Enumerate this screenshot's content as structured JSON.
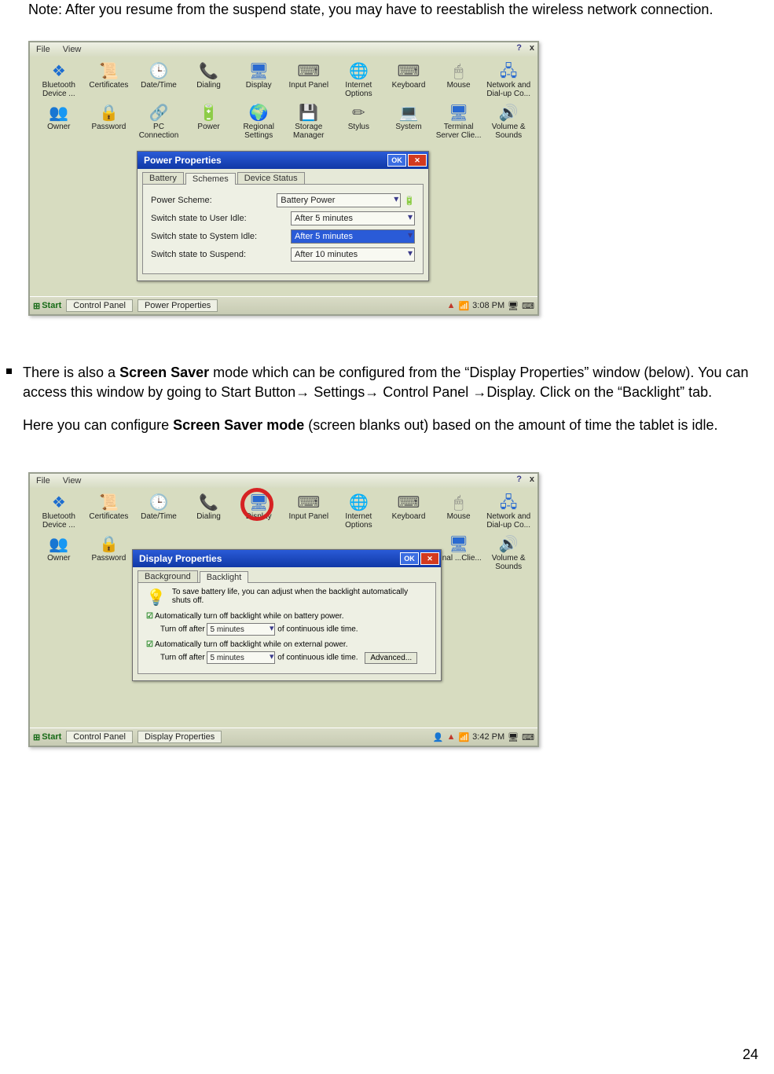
{
  "note": "Note:  After you resume from the suspend state, you may have to reestablish the wireless network connection.",
  "bullet": {
    "part1": "There is also a ",
    "bold1": "Screen Saver",
    "part2": " mode which can be configured from the “Display Properties” window (below).  You can access this window by going to Start Button",
    "arrow": "→",
    "settings": " Settings",
    "control_panel": " Control Panel ",
    "display_text": "Display.  Click on the “Backlight” tab."
  },
  "subpara": {
    "part1": "Here you can configure ",
    "bold": "Screen Saver mode",
    "part2": " (screen blanks out) based on the amount of time the tablet is idle."
  },
  "page_number": "24",
  "shot1": {
    "menu": {
      "file": "File",
      "view": "View",
      "help": "?",
      "close": "x"
    },
    "icons_row1": [
      "Bluetooth Device ...",
      "Certificates",
      "Date/Time",
      "Dialing",
      "Display",
      "Input Panel",
      "Internet Options",
      "Keyboard",
      "Mouse",
      "Network and Dial-up Co..."
    ],
    "icons_row2": [
      "Owner",
      "Password",
      "PC Connection",
      "Power",
      "Regional Settings",
      "Storage Manager",
      "Stylus",
      "System",
      "Terminal Server Clie...",
      "Volume & Sounds"
    ],
    "dialog": {
      "title": "Power Properties",
      "ok": "OK",
      "tabs": [
        "Battery",
        "Schemes",
        "Device Status"
      ],
      "active_tab": 1,
      "fields": {
        "scheme_label": "Power Scheme:",
        "scheme_value": "Battery Power",
        "user_idle_label": "Switch state to User Idle:",
        "user_idle_value": "After 5 minutes",
        "system_idle_label": "Switch state to System Idle:",
        "system_idle_value": "After 5 minutes",
        "suspend_label": "Switch state to Suspend:",
        "suspend_value": "After 10 minutes"
      }
    },
    "taskbar": {
      "start": "Start",
      "task1": "Control Panel",
      "task2": "Power Properties",
      "time": "3:08 PM"
    }
  },
  "shot2": {
    "menu": {
      "file": "File",
      "view": "View",
      "help": "?",
      "close": "x"
    },
    "icons_row1": [
      "Bluetooth Device ...",
      "Certificates",
      "Date/Time",
      "Dialing",
      "Display",
      "Input Panel",
      "Internet Options",
      "Keyboard",
      "Mouse",
      "Network and Dial-up Co..."
    ],
    "icons_row2_partial": [
      "Owner",
      "Password"
    ],
    "icons_row2_trail": [
      "...nal ...Clie...",
      "Volume & Sounds"
    ],
    "dialog": {
      "title": "Display Properties",
      "ok": "OK",
      "tabs": [
        "Background",
        "Backlight"
      ],
      "active_tab": 1,
      "blurb": "To save battery life, you can adjust when the backlight automatically shuts off.",
      "check1": "Automatically turn off backlight while on battery power.",
      "row1_pre": "Turn off after",
      "row1_val": "5 minutes",
      "row1_post": "of continuous idle time.",
      "check2": "Automatically turn off backlight while on external power.",
      "row2_pre": "Turn off after",
      "row2_val": "5 minutes",
      "row2_post": "of continuous idle time.",
      "advanced": "Advanced..."
    },
    "taskbar": {
      "start": "Start",
      "task1": "Control Panel",
      "task2": "Display Properties",
      "time": "3:42 PM"
    }
  }
}
